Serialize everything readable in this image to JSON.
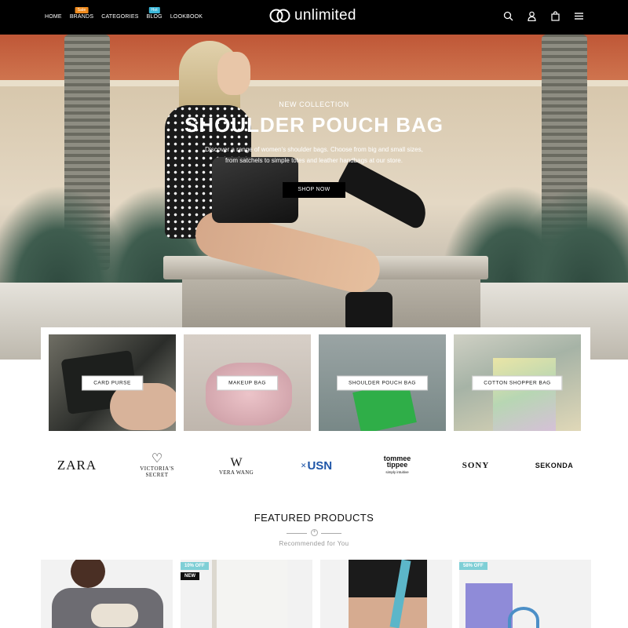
{
  "nav": {
    "items": [
      {
        "label": "HOME",
        "badge": ""
      },
      {
        "label": "BRANDS",
        "badge": "Sale",
        "badge_color": "#f08b1e"
      },
      {
        "label": "CATEGORIES",
        "badge": ""
      },
      {
        "label": "BLOG",
        "badge": "Hot",
        "badge_color": "#3bb7d9"
      },
      {
        "label": "LOOKBOOK",
        "badge": ""
      }
    ],
    "icons": [
      "search-icon",
      "user-icon",
      "bag-icon",
      "menu-icon"
    ]
  },
  "logo": {
    "text": "unlimited"
  },
  "hero": {
    "eyebrow": "NEW COLLECTION",
    "title": "SHOULDER POUCH BAG",
    "desc_line1": "Discover a range of women's shoulder bags. Choose from big and small sizes,",
    "desc_line2": "from satchels to simple totes and leather handbags at our store.",
    "button": "SHOP NOW"
  },
  "categories": [
    {
      "label": "CARD PURSE"
    },
    {
      "label": "MAKEUP BAG"
    },
    {
      "label": "SHOULDER POUCH BAG"
    },
    {
      "label": "COTTON SHOPPER BAG"
    }
  ],
  "brands": {
    "zara": "ZARA",
    "victoria_line1": "VICTORIA'S",
    "victoria_line2": "SECRET",
    "verawang": "VERA WANG",
    "usn": "USN",
    "tommee_line1": "tommee",
    "tommee_line2": "tippee",
    "tommee_tag": "simply intuitive",
    "sony": "SONY",
    "sekonda": "SEKONDA"
  },
  "featured": {
    "title": "FEATURED PRODUCTS",
    "subtitle": "Recommended for You"
  },
  "products": [
    {
      "tags": []
    },
    {
      "tags": [
        {
          "text": "10% OFF",
          "color": "#7fcfd6"
        },
        {
          "text": "NEW",
          "color": "#111111"
        }
      ]
    },
    {
      "tags": []
    },
    {
      "tags": [
        {
          "text": "58% OFF",
          "color": "#7fcfd6"
        }
      ]
    }
  ]
}
